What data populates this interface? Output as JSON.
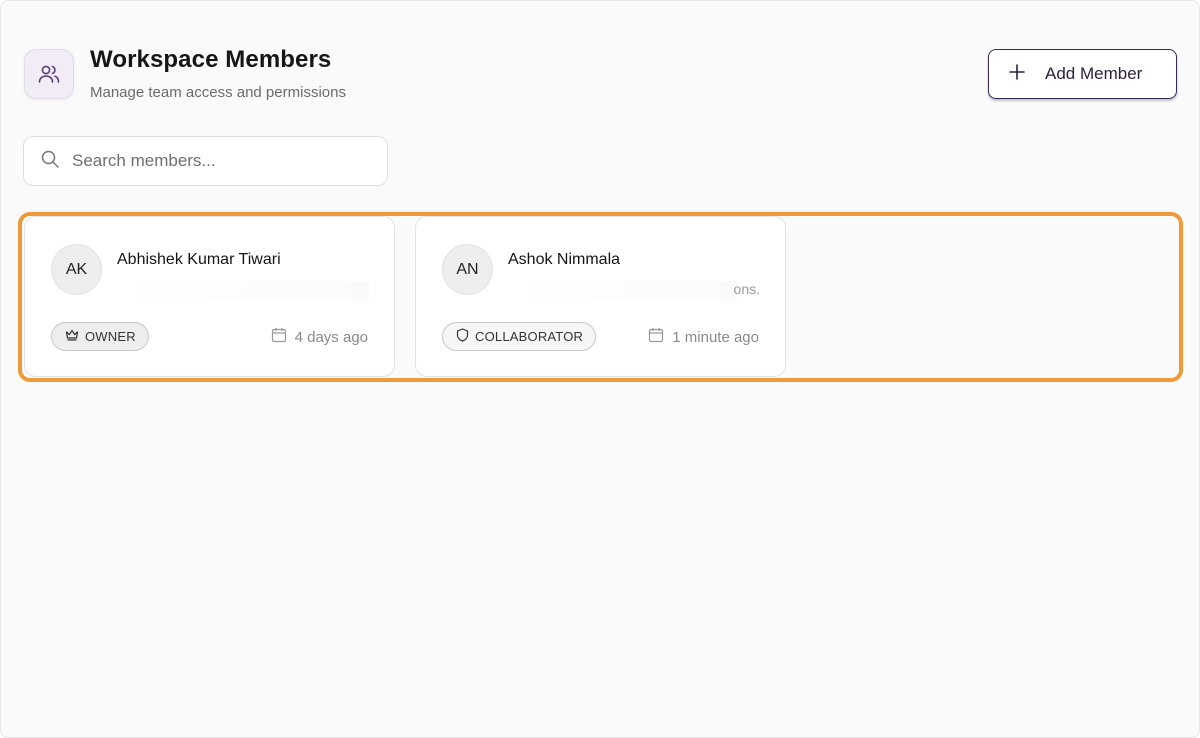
{
  "header": {
    "title": "Workspace Members",
    "subtitle": "Manage team access and permissions",
    "icon": "users-icon",
    "add_button_label": "Add Member"
  },
  "search": {
    "placeholder": "Search members...",
    "value": ""
  },
  "members": [
    {
      "initials": "AK",
      "name": "Abhishek Kumar Tiwari",
      "email": "",
      "role": "OWNER",
      "role_icon": "crown-icon",
      "joined": "4 days ago"
    },
    {
      "initials": "AN",
      "name": "Ashok Nimmala",
      "email": "ons.",
      "role": "COLLABORATOR",
      "role_icon": "shield-icon",
      "joined": "1 minute ago"
    }
  ],
  "colors": {
    "accent": "#3a2a52",
    "highlight": "#ee9a3a",
    "header_icon_bg": "#f1ecf6"
  }
}
